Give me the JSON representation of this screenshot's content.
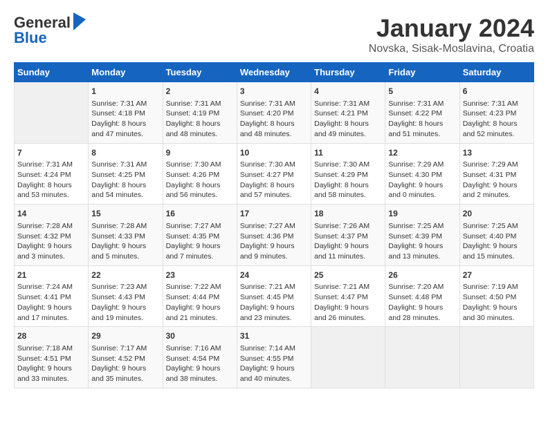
{
  "logo": {
    "general": "General",
    "blue": "Blue"
  },
  "title": "January 2024",
  "subtitle": "Novska, Sisak-Moslavina, Croatia",
  "days_of_week": [
    "Sunday",
    "Monday",
    "Tuesday",
    "Wednesday",
    "Thursday",
    "Friday",
    "Saturday"
  ],
  "weeks": [
    [
      {
        "day": "",
        "sunrise": "",
        "sunset": "",
        "daylight": "",
        "empty": true
      },
      {
        "day": "1",
        "sunrise": "Sunrise: 7:31 AM",
        "sunset": "Sunset: 4:18 PM",
        "daylight": "Daylight: 8 hours and 47 minutes."
      },
      {
        "day": "2",
        "sunrise": "Sunrise: 7:31 AM",
        "sunset": "Sunset: 4:19 PM",
        "daylight": "Daylight: 8 hours and 48 minutes."
      },
      {
        "day": "3",
        "sunrise": "Sunrise: 7:31 AM",
        "sunset": "Sunset: 4:20 PM",
        "daylight": "Daylight: 8 hours and 48 minutes."
      },
      {
        "day": "4",
        "sunrise": "Sunrise: 7:31 AM",
        "sunset": "Sunset: 4:21 PM",
        "daylight": "Daylight: 8 hours and 49 minutes."
      },
      {
        "day": "5",
        "sunrise": "Sunrise: 7:31 AM",
        "sunset": "Sunset: 4:22 PM",
        "daylight": "Daylight: 8 hours and 51 minutes."
      },
      {
        "day": "6",
        "sunrise": "Sunrise: 7:31 AM",
        "sunset": "Sunset: 4:23 PM",
        "daylight": "Daylight: 8 hours and 52 minutes."
      }
    ],
    [
      {
        "day": "7",
        "sunrise": "Sunrise: 7:31 AM",
        "sunset": "Sunset: 4:24 PM",
        "daylight": "Daylight: 8 hours and 53 minutes."
      },
      {
        "day": "8",
        "sunrise": "Sunrise: 7:31 AM",
        "sunset": "Sunset: 4:25 PM",
        "daylight": "Daylight: 8 hours and 54 minutes."
      },
      {
        "day": "9",
        "sunrise": "Sunrise: 7:30 AM",
        "sunset": "Sunset: 4:26 PM",
        "daylight": "Daylight: 8 hours and 56 minutes."
      },
      {
        "day": "10",
        "sunrise": "Sunrise: 7:30 AM",
        "sunset": "Sunset: 4:27 PM",
        "daylight": "Daylight: 8 hours and 57 minutes."
      },
      {
        "day": "11",
        "sunrise": "Sunrise: 7:30 AM",
        "sunset": "Sunset: 4:29 PM",
        "daylight": "Daylight: 8 hours and 58 minutes."
      },
      {
        "day": "12",
        "sunrise": "Sunrise: 7:29 AM",
        "sunset": "Sunset: 4:30 PM",
        "daylight": "Daylight: 9 hours and 0 minutes."
      },
      {
        "day": "13",
        "sunrise": "Sunrise: 7:29 AM",
        "sunset": "Sunset: 4:31 PM",
        "daylight": "Daylight: 9 hours and 2 minutes."
      }
    ],
    [
      {
        "day": "14",
        "sunrise": "Sunrise: 7:28 AM",
        "sunset": "Sunset: 4:32 PM",
        "daylight": "Daylight: 9 hours and 3 minutes."
      },
      {
        "day": "15",
        "sunrise": "Sunrise: 7:28 AM",
        "sunset": "Sunset: 4:33 PM",
        "daylight": "Daylight: 9 hours and 5 minutes."
      },
      {
        "day": "16",
        "sunrise": "Sunrise: 7:27 AM",
        "sunset": "Sunset: 4:35 PM",
        "daylight": "Daylight: 9 hours and 7 minutes."
      },
      {
        "day": "17",
        "sunrise": "Sunrise: 7:27 AM",
        "sunset": "Sunset: 4:36 PM",
        "daylight": "Daylight: 9 hours and 9 minutes."
      },
      {
        "day": "18",
        "sunrise": "Sunrise: 7:26 AM",
        "sunset": "Sunset: 4:37 PM",
        "daylight": "Daylight: 9 hours and 11 minutes."
      },
      {
        "day": "19",
        "sunrise": "Sunrise: 7:25 AM",
        "sunset": "Sunset: 4:39 PM",
        "daylight": "Daylight: 9 hours and 13 minutes."
      },
      {
        "day": "20",
        "sunrise": "Sunrise: 7:25 AM",
        "sunset": "Sunset: 4:40 PM",
        "daylight": "Daylight: 9 hours and 15 minutes."
      }
    ],
    [
      {
        "day": "21",
        "sunrise": "Sunrise: 7:24 AM",
        "sunset": "Sunset: 4:41 PM",
        "daylight": "Daylight: 9 hours and 17 minutes."
      },
      {
        "day": "22",
        "sunrise": "Sunrise: 7:23 AM",
        "sunset": "Sunset: 4:43 PM",
        "daylight": "Daylight: 9 hours and 19 minutes."
      },
      {
        "day": "23",
        "sunrise": "Sunrise: 7:22 AM",
        "sunset": "Sunset: 4:44 PM",
        "daylight": "Daylight: 9 hours and 21 minutes."
      },
      {
        "day": "24",
        "sunrise": "Sunrise: 7:21 AM",
        "sunset": "Sunset: 4:45 PM",
        "daylight": "Daylight: 9 hours and 23 minutes."
      },
      {
        "day": "25",
        "sunrise": "Sunrise: 7:21 AM",
        "sunset": "Sunset: 4:47 PM",
        "daylight": "Daylight: 9 hours and 26 minutes."
      },
      {
        "day": "26",
        "sunrise": "Sunrise: 7:20 AM",
        "sunset": "Sunset: 4:48 PM",
        "daylight": "Daylight: 9 hours and 28 minutes."
      },
      {
        "day": "27",
        "sunrise": "Sunrise: 7:19 AM",
        "sunset": "Sunset: 4:50 PM",
        "daylight": "Daylight: 9 hours and 30 minutes."
      }
    ],
    [
      {
        "day": "28",
        "sunrise": "Sunrise: 7:18 AM",
        "sunset": "Sunset: 4:51 PM",
        "daylight": "Daylight: 9 hours and 33 minutes."
      },
      {
        "day": "29",
        "sunrise": "Sunrise: 7:17 AM",
        "sunset": "Sunset: 4:52 PM",
        "daylight": "Daylight: 9 hours and 35 minutes."
      },
      {
        "day": "30",
        "sunrise": "Sunrise: 7:16 AM",
        "sunset": "Sunset: 4:54 PM",
        "daylight": "Daylight: 9 hours and 38 minutes."
      },
      {
        "day": "31",
        "sunrise": "Sunrise: 7:14 AM",
        "sunset": "Sunset: 4:55 PM",
        "daylight": "Daylight: 9 hours and 40 minutes."
      },
      {
        "day": "",
        "sunrise": "",
        "sunset": "",
        "daylight": "",
        "empty": true
      },
      {
        "day": "",
        "sunrise": "",
        "sunset": "",
        "daylight": "",
        "empty": true
      },
      {
        "day": "",
        "sunrise": "",
        "sunset": "",
        "daylight": "",
        "empty": true
      }
    ]
  ]
}
